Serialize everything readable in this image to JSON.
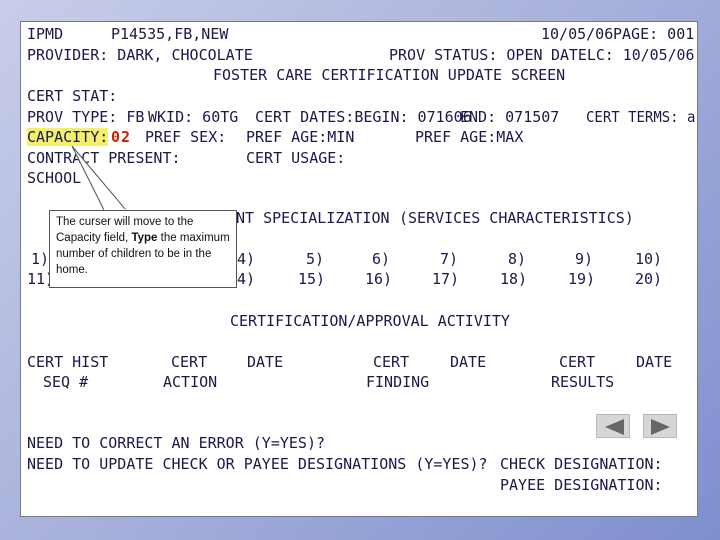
{
  "screen": {
    "header": {
      "system": "IPMD",
      "case_id": "P14535,FB,NEW",
      "date": "10/05/06",
      "page": "PAGE: 001",
      "provider": "PROVIDER: DARK, CHOCOLATE",
      "prov_status": "PROV STATUS: OPEN",
      "datelc": "DATELC: 10/05/06",
      "screen_title": "FOSTER CARE CERTIFICATION UPDATE SCREEN"
    },
    "fields": {
      "cert_stat": "CERT STAT:",
      "prov_type": "PROV TYPE: FB",
      "wkid": "WKID: 60TG",
      "cert_dates_begin": "CERT DATES:BEGIN: 071606",
      "cert_dates_end": "END: 071507",
      "cert_terms": "CERT TERMS: a",
      "capacity_label": "CAPACITY:",
      "capacity_value": "02",
      "pref_sex": "PREF SEX:",
      "pref_age_min": "PREF AGE:MIN",
      "pref_age_max": "PREF AGE:MAX",
      "contract_present": "CONTRACT PRESENT:",
      "cert_usage": "CERT USAGE:",
      "school": "SCHOOL"
    },
    "specialization": {
      "title": "NT SPECIALIZATION",
      "characteristics": "(SERVICES CHARACTERISTICS)",
      "row1": [
        "1)",
        "4)",
        "5)",
        "6)",
        "7)",
        "8)",
        "9)",
        "10)"
      ],
      "row2": [
        "11)",
        "4)",
        "15)",
        "16)",
        "17)",
        "18)",
        "19)",
        "20)"
      ]
    },
    "activity": {
      "title": "CERTIFICATION/APPROVAL ACTIVITY",
      "headers": [
        "CERT HIST",
        "SEQ #",
        "CERT",
        "ACTION",
        "DATE",
        "CERT",
        "FINDING",
        "DATE",
        "CERT",
        "RESULTS",
        "DATE"
      ]
    },
    "questions": {
      "correct_error": "NEED TO CORRECT AN ERROR (Y=YES)?",
      "update_check": "NEED TO UPDATE CHECK OR PAYEE DESIGNATIONS (Y=YES)?",
      "check_designation": "CHECK DESIGNATION:",
      "payee_designation": "PAYEE DESIGNATION:"
    }
  },
  "callout": {
    "text_before": "The curser will move to the Capacity field, ",
    "text_bold": "Type",
    "text_after": " the maximum number of children to be in the home."
  },
  "nav": {
    "back_icon": "triangle-left-icon",
    "forward_icon": "triangle-right-icon"
  },
  "colors": {
    "terminal_text": "#1a1a4a",
    "highlight": "#f5f06a",
    "capacity_value": "#cc2200",
    "background_gradient_start": "#c8cde9",
    "background_gradient_end": "#7f8fcf"
  }
}
